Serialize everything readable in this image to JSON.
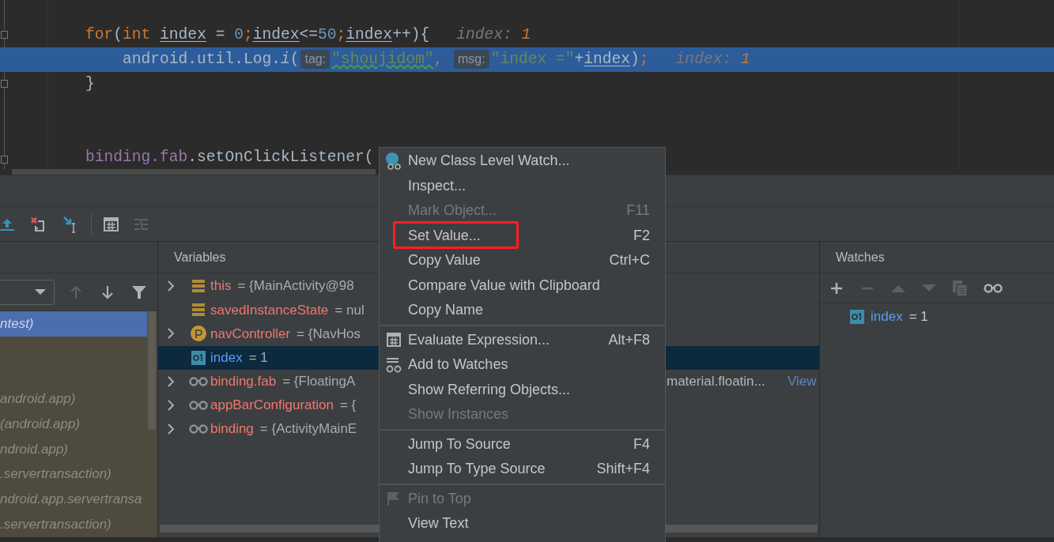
{
  "editor": {
    "lines": [
      {
        "current": false,
        "tokens": [
          {
            "kind": "kw",
            "text": "for"
          },
          {
            "kind": "plain",
            "text": "("
          },
          {
            "kind": "kw",
            "text": "int "
          },
          {
            "kind": "var",
            "text": "index"
          },
          {
            "kind": "plain",
            "text": " = "
          },
          {
            "kind": "num",
            "text": "0"
          },
          {
            "kind": "kw",
            "text": ";"
          },
          {
            "kind": "var",
            "text": "index"
          },
          {
            "kind": "plain",
            "text": "<="
          },
          {
            "kind": "num",
            "text": "50"
          },
          {
            "kind": "kw",
            "text": ";"
          },
          {
            "kind": "var",
            "text": "index"
          },
          {
            "kind": "plain",
            "text": "++){"
          },
          {
            "kind": "debug-name",
            "text": "index: "
          },
          {
            "kind": "debug-value",
            "text": "1"
          }
        ]
      },
      {
        "current": true,
        "tokens": [
          {
            "kind": "plain",
            "text": "    android.util.Log."
          },
          {
            "kind": "method",
            "text": "i"
          },
          {
            "kind": "plain",
            "text": "("
          },
          {
            "kind": "inlay",
            "text": "tag:"
          },
          {
            "kind": "str-squiggle",
            "text": "\"shoujidom\""
          },
          {
            "kind": "kw",
            "text": ", "
          },
          {
            "kind": "inlay",
            "text": "msg:"
          },
          {
            "kind": "str",
            "text": "\"index =\""
          },
          {
            "kind": "plain",
            "text": "+"
          },
          {
            "kind": "var",
            "text": "index"
          },
          {
            "kind": "plain",
            "text": ")"
          },
          {
            "kind": "kw",
            "text": ";"
          },
          {
            "kind": "debug-name",
            "text": "index: "
          },
          {
            "kind": "debug-value",
            "text": "1"
          }
        ]
      },
      {
        "current": false,
        "tokens": [
          {
            "kind": "plain",
            "text": "}"
          }
        ]
      },
      {
        "current": false,
        "tokens": [
          {
            "kind": "field",
            "text": "binding.fab"
          },
          {
            "kind": "plain",
            "text": ".setOnClickListener("
          }
        ]
      }
    ]
  },
  "frames": {
    "rows": [
      {
        "text": "ntest)",
        "selected": true
      },
      {
        "text": "android.app)",
        "selected": false
      },
      {
        "text": "(android.app)",
        "selected": false
      },
      {
        "text": "ndroid.app)",
        "selected": false
      },
      {
        "text": ".servertransaction)",
        "selected": false
      },
      {
        "text": "ndroid.app.servertransa",
        "selected": false
      },
      {
        "text": ".servertransaction)",
        "selected": false
      }
    ]
  },
  "variables": {
    "title": "Variables",
    "rows": [
      {
        "kind": "field",
        "expandable": true,
        "name": "this",
        "value": "= {MainActivity@98",
        "selected": false,
        "changed": false
      },
      {
        "kind": "field",
        "expandable": false,
        "name": "savedInstanceState",
        "value": "= nul",
        "selected": false,
        "changed": false
      },
      {
        "kind": "param",
        "expandable": true,
        "name": "navController",
        "value": "= {NavHos",
        "selected": false,
        "changed": false
      },
      {
        "kind": "primitive",
        "expandable": false,
        "name": "index",
        "value": "= 1",
        "selected": true,
        "changed": true
      },
      {
        "kind": "watch",
        "expandable": true,
        "name": "binding.fab",
        "value": "= {FloatingA",
        "selected": false,
        "changed": false,
        "tail": "material.floatin...",
        "link": "View"
      },
      {
        "kind": "watch",
        "expandable": true,
        "name": "appBarConfiguration",
        "value": "= {",
        "selected": false,
        "changed": false
      },
      {
        "kind": "watch",
        "expandable": true,
        "name": "binding",
        "value": "= {ActivityMainE",
        "selected": false,
        "changed": false
      }
    ]
  },
  "watches": {
    "title": "Watches",
    "items": [
      {
        "kind": "primitive",
        "name": "index",
        "value": "= 1",
        "changed": true
      }
    ]
  },
  "menu": {
    "groups": [
      {
        "items": [
          {
            "kind": "class-watch",
            "label": "New Class Level Watch...",
            "disabled": false,
            "highlighted": false
          },
          {
            "kind": "plain",
            "label": "Inspect...",
            "disabled": false,
            "highlighted": false
          },
          {
            "kind": "plain",
            "label": "Mark Object...",
            "shortcut": "F11",
            "disabled": true,
            "highlighted": false
          },
          {
            "kind": "plain",
            "label": "Set Value...",
            "shortcut": "F2",
            "disabled": false,
            "highlighted": true
          },
          {
            "kind": "plain",
            "label": "Copy Value",
            "shortcut": "Ctrl+C",
            "disabled": false,
            "highlighted": false
          },
          {
            "kind": "plain",
            "label": "Compare Value with Clipboard",
            "disabled": false,
            "highlighted": false
          },
          {
            "kind": "plain",
            "label": "Copy Name",
            "disabled": false,
            "highlighted": false
          }
        ]
      },
      {
        "items": [
          {
            "kind": "calculator",
            "label": "Evaluate Expression...",
            "shortcut": "Alt+F8",
            "disabled": false,
            "highlighted": false
          },
          {
            "kind": "add-watch",
            "label": "Add to Watches",
            "disabled": false,
            "highlighted": false
          },
          {
            "kind": "plain",
            "label": "Show Referring Objects...",
            "disabled": false,
            "highlighted": false
          },
          {
            "kind": "plain",
            "label": "Show Instances",
            "disabled": true,
            "highlighted": false
          }
        ]
      },
      {
        "items": [
          {
            "kind": "plain",
            "label": "Jump To Source",
            "shortcut": "F4",
            "disabled": false,
            "highlighted": false
          },
          {
            "kind": "plain",
            "label": "Jump To Type Source",
            "shortcut": "Shift+F4",
            "disabled": false,
            "highlighted": false
          }
        ]
      },
      {
        "items": [
          {
            "kind": "pin",
            "label": "Pin to Top",
            "disabled": true,
            "highlighted": false
          },
          {
            "kind": "plain",
            "label": "View Text",
            "disabled": false,
            "highlighted": false
          }
        ]
      }
    ]
  }
}
